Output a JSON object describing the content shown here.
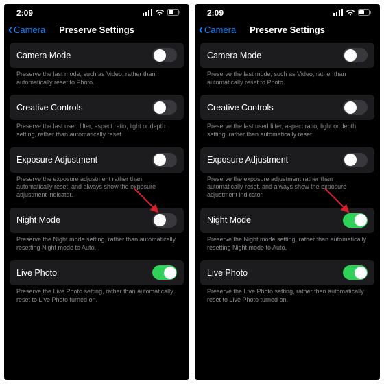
{
  "status": {
    "time": "2:09"
  },
  "nav": {
    "back_label": "Camera",
    "title": "Preserve Settings"
  },
  "settings": [
    {
      "label": "Camera Mode",
      "desc": "Preserve the last mode, such as Video, rather than automatically reset to Photo."
    },
    {
      "label": "Creative Controls",
      "desc": "Preserve the last used filter, aspect ratio, light or depth setting, rather than automatically reset."
    },
    {
      "label": "Exposure Adjustment",
      "desc": "Preserve the exposure adjustment rather than automatically reset, and always show the exposure adjustment indicator."
    },
    {
      "label": "Night Mode",
      "desc": "Preserve the Night mode setting, rather than automatically resetting Night mode to Auto."
    },
    {
      "label": "Live Photo",
      "desc": "Preserve the Live Photo setting, rather than automatically reset to Live Photo turned on."
    }
  ],
  "screens": [
    {
      "toggles": [
        false,
        false,
        false,
        false,
        true
      ]
    },
    {
      "toggles": [
        false,
        false,
        false,
        true,
        true
      ]
    }
  ],
  "annotation": {
    "color": "#d4202a",
    "target_index": 3
  }
}
